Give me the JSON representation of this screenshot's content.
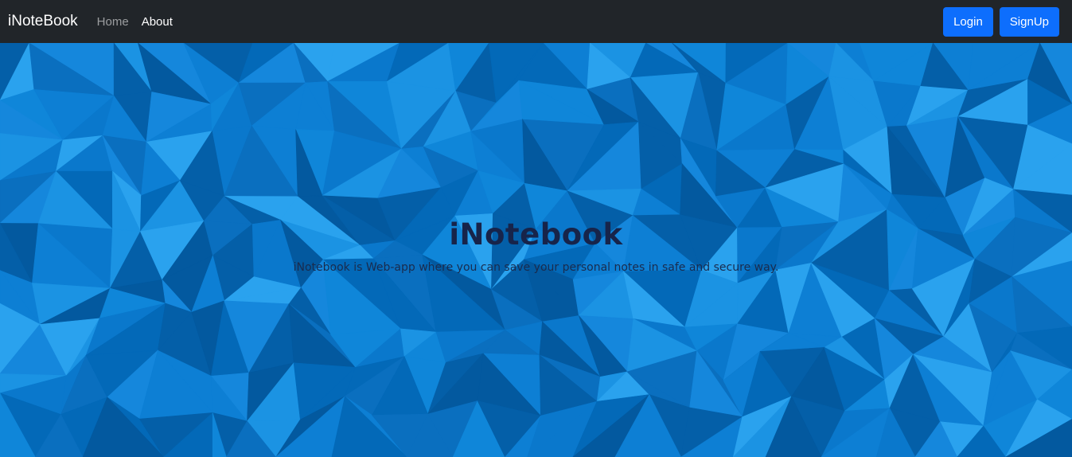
{
  "navbar": {
    "brand": "iNoteBook",
    "links": [
      {
        "label": "Home"
      },
      {
        "label": "About"
      }
    ],
    "login_label": "Login",
    "signup_label": "SignUp"
  },
  "hero": {
    "title": "iNotebook",
    "description": "iNotebook is Web-app where you can save your personal notes in safe and secure way."
  },
  "colors": {
    "navbar_bg": "#212529",
    "button_primary": "#0d6efd",
    "hero_base": "#0a78cc",
    "hero_text": "#17244a"
  }
}
